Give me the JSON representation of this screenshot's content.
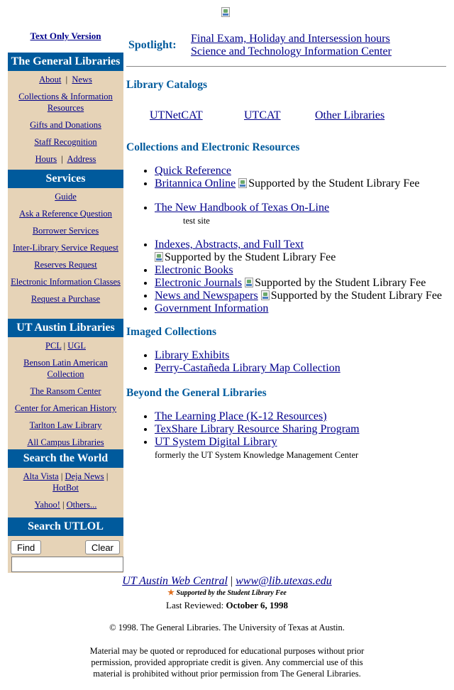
{
  "header": {
    "text_only": "Text Only Version"
  },
  "sidebar": {
    "general": {
      "title": "The General Libraries",
      "about": "About",
      "news": "News",
      "sep": "|",
      "collections": "Collections & Information Resources",
      "gifts": "Gifts and Donations",
      "staff": "Staff Recognition",
      "hours": "Hours",
      "address": "Address"
    },
    "services": {
      "title": "Services",
      "items": [
        "Guide",
        "Ask a Reference Question",
        "Borrower Services",
        "Inter-Library Service Request",
        "Reserves Request",
        "Electronic Information Classes",
        "Request a Purchase"
      ]
    },
    "ut_libraries": {
      "title": "UT Austin Libraries",
      "pcl": "PCL",
      "ugl": "UGL",
      "items": [
        "Benson Latin American Collection",
        "The Ransom Center",
        "Center for American History",
        "Tarlton Law Library",
        "All Campus Libraries"
      ]
    },
    "search_world": {
      "title": "Search the World",
      "alta": "Alta Vista",
      "deja": "Deja News",
      "hotbot": "HotBot",
      "yahoo": "Yahoo!",
      "others": "Others..."
    },
    "utlol": {
      "title": "Search UTLOL",
      "find": "Find",
      "clear": "Clear"
    }
  },
  "spotlight": {
    "label": "Spotlight:",
    "links": [
      "Final Exam, Holiday and Intersession hours",
      "Science and Technology Information Center"
    ]
  },
  "catalogs": {
    "title": "Library Catalogs",
    "links": [
      "UTNetCAT",
      "UTCAT",
      "Other Libraries"
    ]
  },
  "collections": {
    "title": "Collections and Electronic Resources",
    "fee_alt": "Supported by the Student Library Fee",
    "quick_ref": "Quick Reference",
    "britannica": "Britannica Online",
    "handbook": "The New Handbook of Texas On-Line",
    "handbook_note": "test site",
    "indexes": "Indexes, Abstracts, and Full Text",
    "ebooks": "Electronic Books",
    "ejournals": "Electronic Journals",
    "news": "News and Newspapers",
    "gov": "Government Information"
  },
  "imaged": {
    "title": "Imaged Collections",
    "links": [
      "Library Exhibits",
      "Perry-Castañeda Library Map Collection"
    ]
  },
  "beyond": {
    "title": "Beyond the General Libraries",
    "learning": "The Learning Place (K-12 Resources)",
    "texshare": "TexShare Library Resource Sharing Program",
    "ut_system": "UT System Digital Library",
    "ut_system_note": "formerly the UT System Knowledge Management Center"
  },
  "footer": {
    "web_central": "UT Austin Web Central",
    "pipe": "|",
    "email": "www@lib.utexas.edu",
    "fee_note": "Supported by the Student Library Fee",
    "reviewed_label": "Last Reviewed:",
    "reviewed_date": "October 6, 1998",
    "copyright": "© 1998. The General Libraries. The University of Texas at Austin.",
    "legal": "Material may be quoted or reproduced for educational purposes without prior permission, provided appropriate credit is given. Any commercial use of this material is prohibited without prior permission from The General Libraries."
  },
  "colors": {
    "section_blue": "#005a9c",
    "sidebar_tan": "#e6d3b7",
    "link": "#00008b"
  },
  "icons": {
    "broken_image": "broken-image-icon",
    "fee_star": "star-icon"
  }
}
